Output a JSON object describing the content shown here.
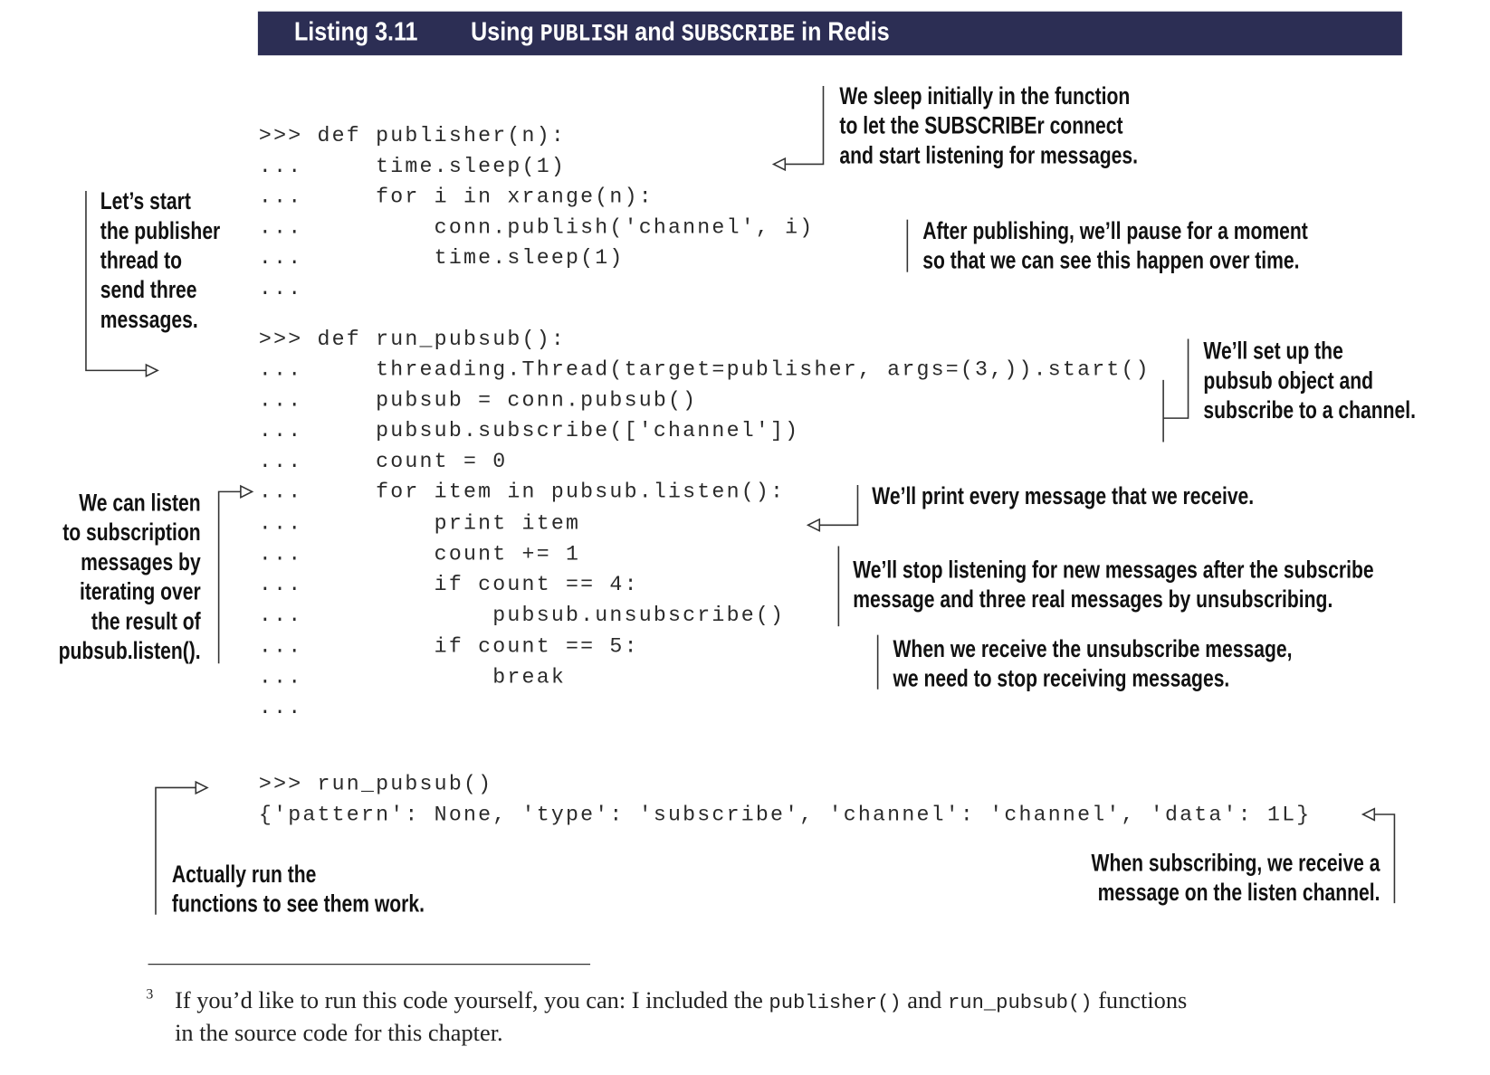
{
  "header": {
    "listing": "Listing 3.11",
    "title_pre": "Using ",
    "title_code1": "PUBLISH",
    "title_mid": " and ",
    "title_code2": "SUBSCRIBE",
    "title_post": " in Redis",
    "background_color": "#2c2e54"
  },
  "code": [
    ">>> def publisher(n):",
    "...     time.sleep(1)",
    "...     for i in xrange(n):",
    "...         conn.publish('channel', i)",
    "...         time.sleep(1)",
    "...",
    ">>> def run_pubsub():",
    "...     threading.Thread(target=publisher, args=(3,)).start()",
    "...     pubsub = conn.pubsub()",
    "...     pubsub.subscribe(['channel'])",
    "...     count = 0",
    "...     for item in pubsub.listen():",
    "...         print item",
    "...         count += 1",
    "...         if count == 4:",
    "...             pubsub.unsubscribe()",
    "...         if count == 5:",
    "...             break",
    "...",
    ">>> run_pubsub()",
    "{'pattern': None, 'type': 'subscribe', 'channel': 'channel', 'data': 1L}"
  ],
  "annotations": {
    "sleep": [
      "We sleep initially in the function",
      "to let the SUBSCRIBEr connect",
      "and start listening for messages."
    ],
    "pause": [
      "After publishing, we’ll pause for a moment",
      "so that we can see this happen over time."
    ],
    "start": [
      "Let’s start",
      "the publisher",
      "thread to",
      "send three",
      "messages."
    ],
    "setup": [
      "We’ll set up the",
      "pubsub object and",
      "subscribe to a channel."
    ],
    "listen": [
      "We can listen",
      "to subscription",
      "messages by",
      "iterating over",
      "the result of",
      "pubsub.listen()."
    ],
    "print": [
      "We’ll print every message that we receive."
    ],
    "stop": [
      "We’ll stop listening for new messages after the subscribe",
      "message and three real messages by unsubscribing."
    ],
    "unsub": [
      "When we receive the unsubscribe message,",
      "we need to stop receiving messages."
    ],
    "run": [
      "Actually run the",
      "functions to see them work."
    ],
    "subscribing": [
      "When subscribing, we receive a",
      "message on the listen channel."
    ]
  },
  "footnote": {
    "marker": "3",
    "text1": "If you’d like to run this code yourself, you can: I included the ",
    "code1": "publisher()",
    "text2": " and ",
    "code2": "run_pubsub()",
    "text3": " functions",
    "line2": "in the source code for this chapter."
  }
}
